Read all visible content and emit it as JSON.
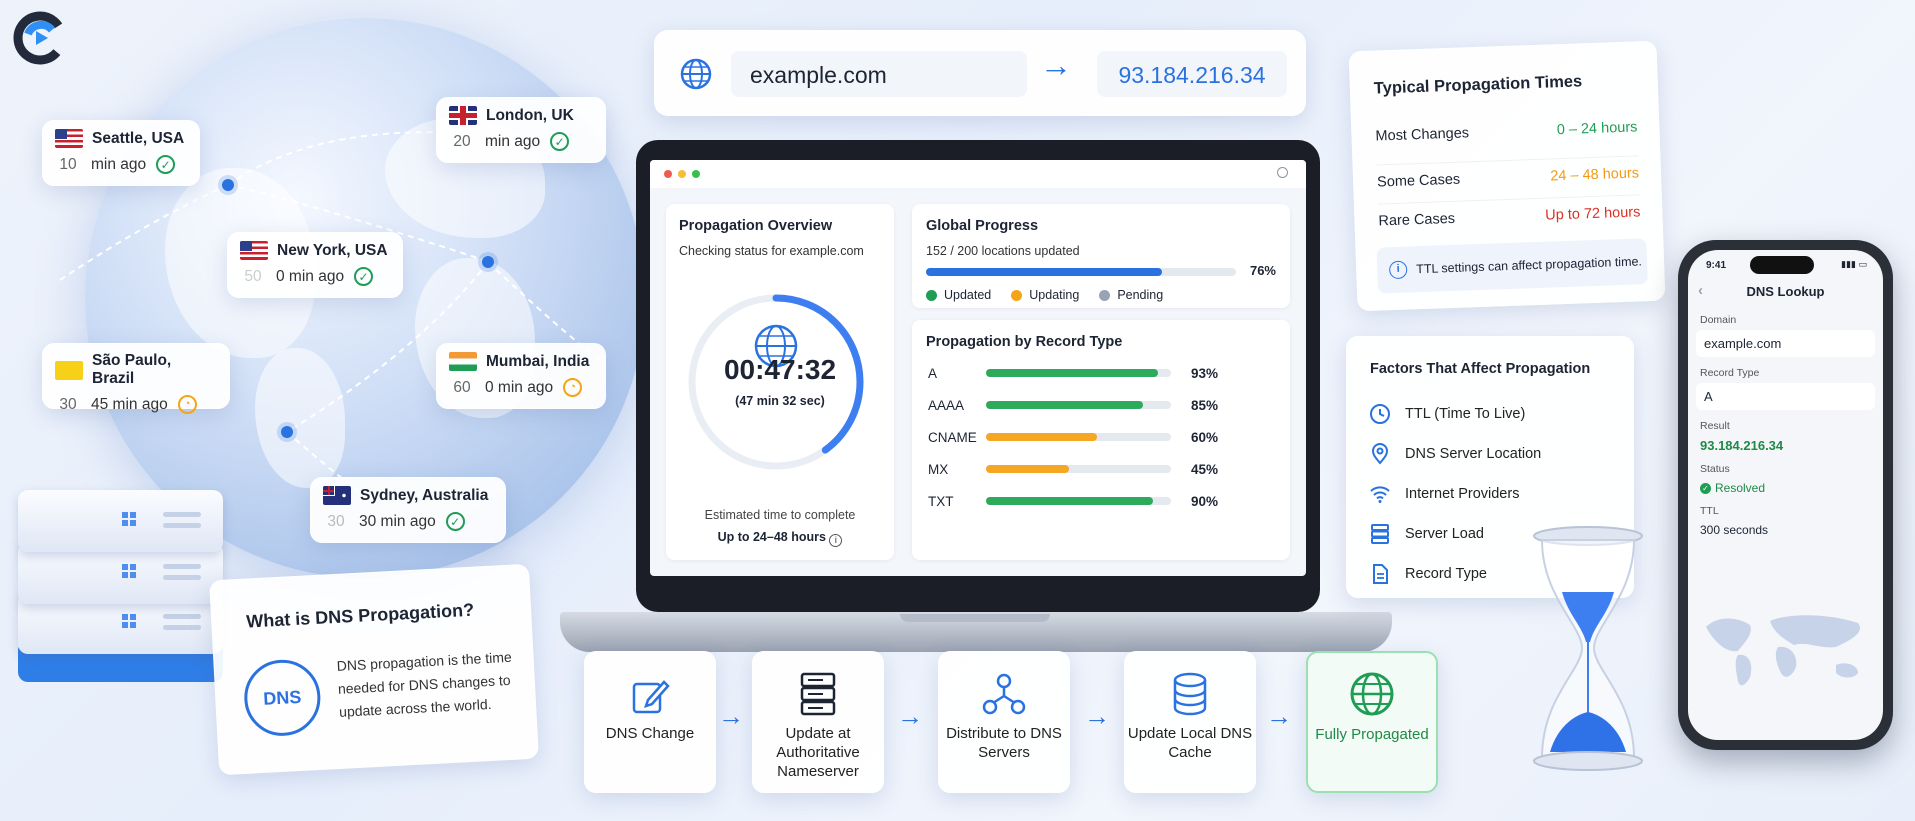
{
  "logo": {
    "icon": "brand-logo-icon"
  },
  "lookup": {
    "domain": "example.com",
    "ip": "93.184.216.34"
  },
  "locations": [
    {
      "city": "Seattle, USA",
      "num": "10",
      "ago": "min ago",
      "status": "done"
    },
    {
      "city": "London, UK",
      "num": "20",
      "ago": "min ago",
      "status": "done"
    },
    {
      "city": "New York, USA",
      "num": "50",
      "ago": "0 min ago",
      "status": "done"
    },
    {
      "city": "São Paulo, Brazil",
      "num": "30",
      "ago": "45 min ago",
      "status": "pending"
    },
    {
      "city": "Mumbai, India",
      "num": "60",
      "ago": "0 min ago",
      "status": "pending"
    },
    {
      "city": "Sydney, Australia",
      "num": "30",
      "ago": "30 min ago",
      "status": "done"
    }
  ],
  "what_is": {
    "title": "What is DNS Propagation?",
    "icon_text": "DNS",
    "body": "DNS propagation is the time needed for DNS changes to update across the world."
  },
  "overview": {
    "title": "Propagation Overview",
    "subtitle": "Checking status for example.com",
    "timer": "00:47:32",
    "timer_sub": "(47 min 32 sec)",
    "progress_fraction": 0.4,
    "est_label": "Estimated time to complete",
    "est_value": "Up to 24–48 hours"
  },
  "global": {
    "title": "Global Progress",
    "count": "152 / 200 locations updated",
    "pct": "76%",
    "value": 76,
    "legend": [
      {
        "label": "Updated",
        "color": "#1f9d55"
      },
      {
        "label": "Updating",
        "color": "#f2a516"
      },
      {
        "label": "Pending",
        "color": "#9aa3b5"
      }
    ]
  },
  "record_types": {
    "title": "Propagation by Record Type",
    "rows": [
      {
        "type": "A",
        "pct": "93%",
        "value": 93,
        "color": "#2eaa5c"
      },
      {
        "type": "AAAA",
        "pct": "85%",
        "value": 85,
        "color": "#2eaa5c"
      },
      {
        "type": "CNAME",
        "pct": "60%",
        "value": 60,
        "color": "#f5a623"
      },
      {
        "type": "MX",
        "pct": "45%",
        "value": 45,
        "color": "#f5a623"
      },
      {
        "type": "TXT",
        "pct": "90%",
        "value": 90,
        "color": "#2eaa5c"
      }
    ]
  },
  "steps": [
    {
      "label": "DNS Change",
      "icon": "edit-icon"
    },
    {
      "label": "Update at Authoritative Nameserver",
      "icon": "server-stack-icon"
    },
    {
      "label": "Distribute to DNS Servers",
      "icon": "network-nodes-icon"
    },
    {
      "label": "Update Local DNS Cache",
      "icon": "database-icon"
    },
    {
      "label": "Fully Propagated",
      "icon": "globe-icon"
    }
  ],
  "typical": {
    "title": "Typical Propagation Times",
    "rows": [
      {
        "label": "Most Changes",
        "value": "0 – 24 hours",
        "color": "#1f9d55"
      },
      {
        "label": "Some Cases",
        "value": "24 – 48 hours",
        "color": "#f29a16"
      },
      {
        "label": "Rare Cases",
        "value": "Up to 72 hours",
        "color": "#d93025"
      }
    ],
    "note": "TTL settings can affect propagation time."
  },
  "factors": {
    "title": "Factors That Affect Propagation",
    "items": [
      {
        "label": "TTL (Time To Live)",
        "icon": "clock-icon"
      },
      {
        "label": "DNS Server Location",
        "icon": "location-pin-icon"
      },
      {
        "label": "Internet Providers",
        "icon": "wifi-icon"
      },
      {
        "label": "Server Load",
        "icon": "server-icon"
      },
      {
        "label": "Record Type",
        "icon": "document-icon"
      }
    ]
  },
  "phone": {
    "time": "9:41",
    "title": "DNS Lookup",
    "domain_label": "Domain",
    "domain": "example.com",
    "record_label": "Record Type",
    "record": "A",
    "result_label": "Result",
    "result": "93.184.216.34",
    "status_label": "Status",
    "status": "Resolved",
    "ttl_label": "TTL",
    "ttl": "300 seconds"
  }
}
